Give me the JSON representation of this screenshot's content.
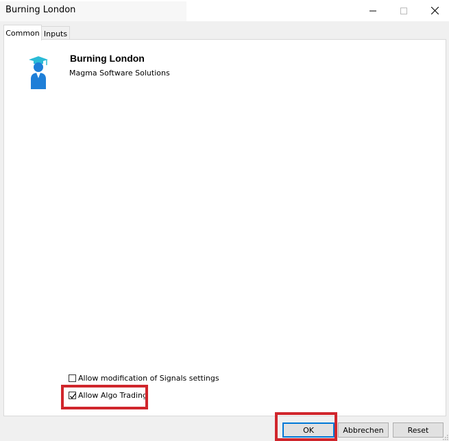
{
  "window": {
    "title": "Burning London"
  },
  "tabs": [
    {
      "label": "Common",
      "active": true
    },
    {
      "label": "Inputs",
      "active": false
    }
  ],
  "expert": {
    "name": "Burning London",
    "company": "Magma Software Solutions",
    "icon": "graduate-avatar-icon"
  },
  "options": {
    "signals_label": "Allow modification of Signals settings",
    "signals_checked": false,
    "algo_label": "Allow Algo Trading",
    "algo_checked": true
  },
  "buttons": {
    "ok_label": "OK",
    "cancel_label": "Abbrechen",
    "reset_label": "Reset"
  },
  "colors": {
    "highlight": "#d0262c",
    "focus": "#0078d7",
    "icon_blue": "#1f7fd8",
    "cap_cyan": "#2bbbd6"
  }
}
